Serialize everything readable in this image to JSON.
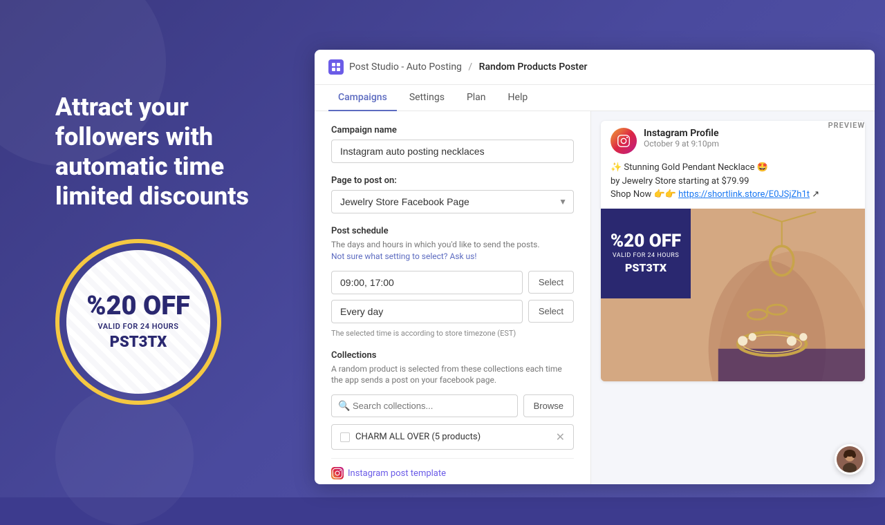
{
  "background": {
    "color": "#3d3b8e"
  },
  "left": {
    "headline": "Attract your followers with automatic time limited discounts",
    "badge": {
      "percent": "%20 OFF",
      "valid": "VALID FOR 24 HOURS",
      "code": "PST3TX"
    }
  },
  "header": {
    "logo_text": "P",
    "breadcrumb_start": "Post Studio - Auto Posting",
    "breadcrumb_separator": "/",
    "breadcrumb_current": "Random Products Poster"
  },
  "nav": {
    "items": [
      {
        "label": "Campaigns",
        "active": true
      },
      {
        "label": "Settings",
        "active": false
      },
      {
        "label": "Plan",
        "active": false
      },
      {
        "label": "Help",
        "active": false
      }
    ]
  },
  "form": {
    "campaign_name_label": "Campaign name",
    "campaign_name_value": "Instagram auto posting necklaces",
    "page_label": "Page to post on:",
    "page_value": "Jewelry Store Facebook Page",
    "post_schedule_title": "Post schedule",
    "post_schedule_desc": "The days and hours in which you'd like to send the posts.",
    "post_schedule_help": "Not sure what setting to select? Ask us!",
    "time_value": "09:00, 17:00",
    "time_select_btn": "Select",
    "day_value": "Every day",
    "day_select_btn": "Select",
    "timezone_note": "The selected time is according to store timezone (EST)",
    "collections_title": "Collections",
    "collections_desc": "A random product is selected from these collections each time the app sends a post on your facebook page.",
    "search_placeholder": "Search collections...",
    "browse_btn": "Browse",
    "collection_name": "CHARM ALL OVER (5 products)",
    "instagram_template_text": "Instagram post template"
  },
  "preview": {
    "label": "PREVIEW",
    "profile_name": "Instagram Profile",
    "profile_date": "October 9 at 9:10pm",
    "caption_line1": "✨ Stunning Gold Pendant Necklace 🤩",
    "caption_line2": "by Jewelry Store starting at $79.99",
    "caption_line3": "Shop Now 👉👉",
    "caption_link": "https://shortlink.store/E0JSjZh1t",
    "discount": {
      "percent": "%20 OFF",
      "valid": "VALID FOR 24 HOURS",
      "code": "PST3TX"
    }
  }
}
